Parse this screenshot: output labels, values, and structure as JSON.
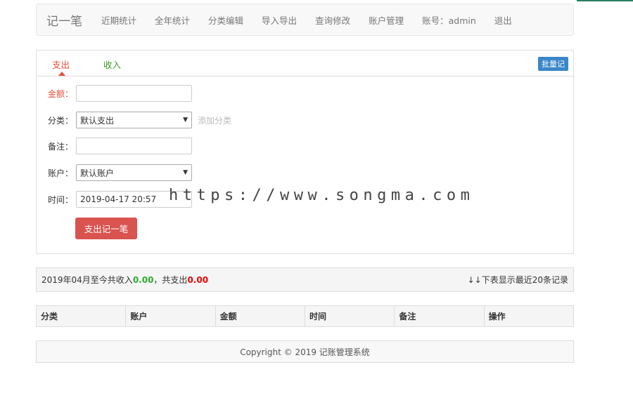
{
  "navbar": {
    "brand": "记一笔",
    "links": [
      "近期统计",
      "全年统计",
      "分类编辑",
      "导入导出",
      "查询修改",
      "账户管理",
      "账号：admin",
      "退出"
    ]
  },
  "tabs": {
    "expense": "支出",
    "income": "收入",
    "batch": "批量记"
  },
  "form": {
    "amount_label": "金额：",
    "amount_value": "",
    "category_label": "分类：",
    "category_value": "默认支出",
    "add_category": "添加分类",
    "note_label": "备注：",
    "note_value": "",
    "account_label": "账户：",
    "account_value": "默认账户",
    "time_label": "时间：",
    "time_value": "2019-04-17 20:57",
    "submit": "支出记一笔"
  },
  "watermark": "https://www.songma.com",
  "summary": {
    "prefix": "2019年04月至今共收入",
    "income": "0.00",
    "middle": "，共支出",
    "expense": "0.00",
    "right": "↓↓下表显示最近20条记录"
  },
  "table": {
    "headers": [
      "分类",
      "账户",
      "金额",
      "时间",
      "备注",
      "操作"
    ]
  },
  "footer": "Copyright © 2019 记账管理系统"
}
